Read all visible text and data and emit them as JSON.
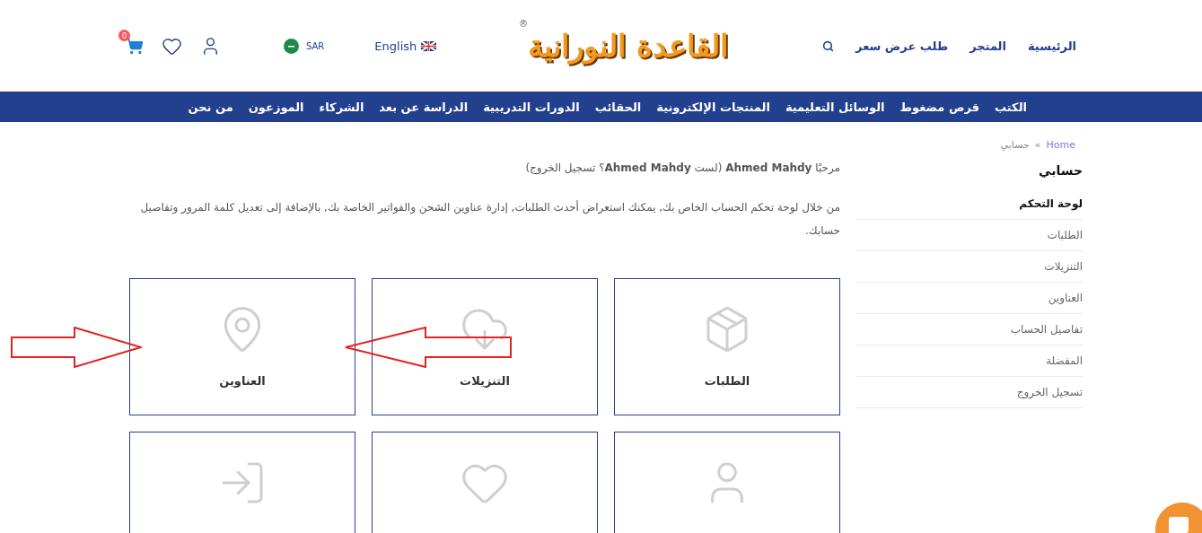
{
  "header": {
    "cart_count": "0",
    "currency": "SAR",
    "language": "English",
    "logo": "القاعدة النورانية",
    "logo_mark": "®",
    "top_links": [
      "الرئيسية",
      "المتجر",
      "طلب عرض سعر"
    ]
  },
  "nav": [
    "الكتب",
    "قرص مضغوط",
    "الوسائل التعليمية",
    "المنتجات الإلكترونية",
    "الحقائب",
    "الدورات التدريبية",
    "الدراسة عن بعد",
    "الشركاء",
    "الموزعون",
    "من نحن"
  ],
  "breadcrumb": {
    "items": [
      "Home",
      "حسابي"
    ],
    "separator": "»"
  },
  "sidebar": {
    "title": "حسابي",
    "items": [
      {
        "label": "لوحة التحكم",
        "selected": true
      },
      {
        "label": "الطلبات",
        "selected": false
      },
      {
        "label": "التنزيلات",
        "selected": false
      },
      {
        "label": "العناوين",
        "selected": false
      },
      {
        "label": "تفاصيل الحساب",
        "selected": false
      },
      {
        "label": "المفضلة",
        "selected": false
      },
      {
        "label": "تسجيل الخروج",
        "selected": false
      }
    ]
  },
  "welcome": "مرحبًا **Ahmed Mahdy** (لست **Ahmed Mahdy**؟ تسجيل الخروج)",
  "intro": "من خلال لوحة تحكم الحساب الخاص بك, يمكنك استعراض أحدث الطلبات, إدارة عناوين الشحن والفواتير الخاصة بك, بالإضافة إلى تعديل كلمة المرور وتفاصيل حسابك.",
  "cards": [
    {
      "kind": "orders",
      "label": "الطلبات"
    },
    {
      "kind": "downloads",
      "label": "التنزيلات"
    },
    {
      "kind": "addresses",
      "label": "العناوين"
    },
    {
      "kind": "account"
    },
    {
      "kind": "wishlist"
    },
    {
      "kind": "logout"
    }
  ],
  "annotations": [
    {
      "kind": "arrow"
    },
    {
      "kind": "arrow"
    }
  ]
}
